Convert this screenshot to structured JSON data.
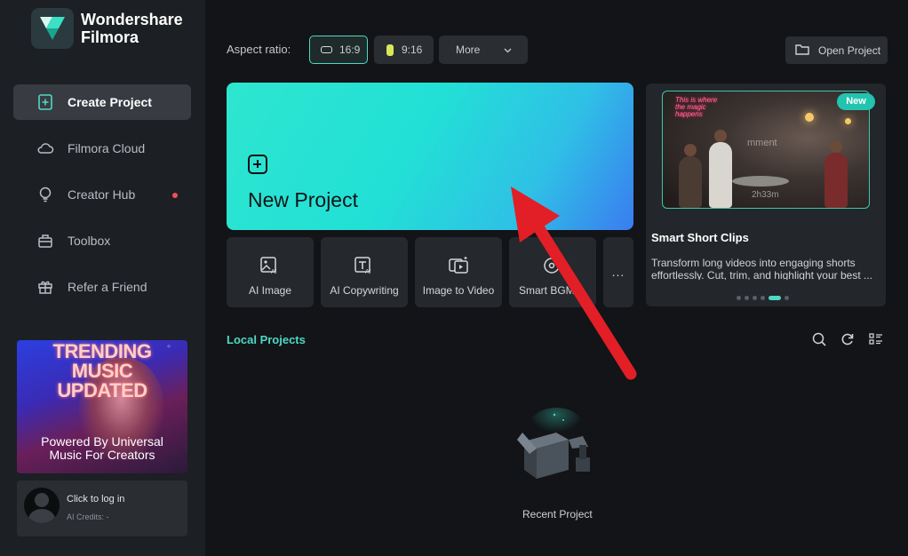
{
  "app": {
    "brand_line1": "Wondershare",
    "brand_line2": "Filmora"
  },
  "sidebar": {
    "items": [
      {
        "label": "Create Project",
        "icon": "plus-square-icon",
        "active": true
      },
      {
        "label": "Filmora Cloud",
        "icon": "cloud-icon"
      },
      {
        "label": "Creator Hub",
        "icon": "bulb-icon",
        "notification_dot": true
      },
      {
        "label": "Toolbox",
        "icon": "toolbox-icon"
      },
      {
        "label": "Refer a Friend",
        "icon": "gift-icon"
      }
    ],
    "promo": {
      "headline": "TRENDING MUSIC UPDATED",
      "subline": "Powered By Universal Music For Creators"
    },
    "login": {
      "prompt": "Click to log in",
      "credits": "AI Credits: -"
    }
  },
  "toolbar": {
    "aspect_label": "Aspect ratio:",
    "ratio_169": "16:9",
    "ratio_916": "9:16",
    "more": "More",
    "open_project": "Open Project"
  },
  "new_project": {
    "label": "New Project"
  },
  "tools": [
    {
      "label": "AI Image",
      "icon": "ai-image-icon"
    },
    {
      "label": "AI Copywriting",
      "icon": "ai-text-icon"
    },
    {
      "label": "Image to Video",
      "icon": "image-video-icon"
    },
    {
      "label": "Smart BGM ...",
      "icon": "music-disc-icon"
    },
    {
      "label": "...",
      "icon": "more-icon"
    }
  ],
  "feature": {
    "badge": "New",
    "title": "Smart Short Clips",
    "description": "Transform long videos into engaging shorts effortlessly. Cut, trim, and highlight your best ...",
    "thumb_neon": "This is where the magic happens",
    "thumb_watermark": "mment",
    "thumb_time": "2h33m",
    "carousel_active_index": 4,
    "carousel_count": 6
  },
  "local_projects": {
    "title": "Local Projects",
    "empty_label": "Recent Project"
  },
  "colors": {
    "accent": "#4fd8c4",
    "arrow": "#e21f26",
    "notify": "#f0505c"
  }
}
